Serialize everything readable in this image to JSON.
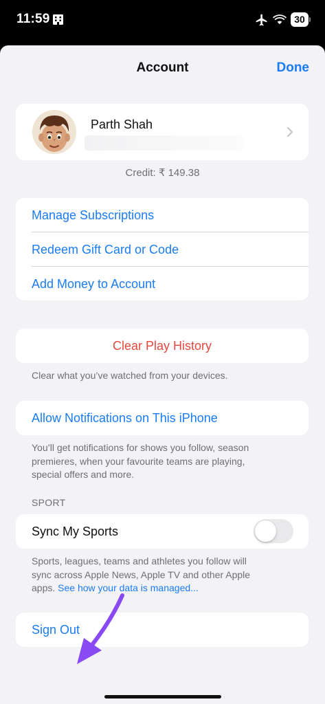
{
  "status_bar": {
    "time": "11:59",
    "battery_level": "30",
    "icons": [
      "building-icon",
      "airplane-icon",
      "wifi-icon",
      "battery-icon"
    ]
  },
  "nav": {
    "title": "Account",
    "done_label": "Done"
  },
  "profile": {
    "name": "Parth Shah",
    "icons": [
      "avatar-memoji",
      "chevron-right-icon"
    ]
  },
  "credit": "Credit: ₹ 149.38",
  "links": [
    {
      "label": "Manage Subscriptions"
    },
    {
      "label": "Redeem Gift Card or Code"
    },
    {
      "label": "Add Money to Account"
    }
  ],
  "clear_history": {
    "label": "Clear Play History",
    "footnote": "Clear what you’ve watched from your devices."
  },
  "notifications": {
    "label": "Allow Notifications on This iPhone",
    "footnote_line1": "You’ll get notifications for shows you follow, season",
    "footnote_line2": "premieres, when your favourite teams are playing,",
    "footnote_line3": "special offers and more."
  },
  "sport": {
    "header": "SPORT",
    "label": "Sync My Sports",
    "toggle_on": false,
    "footnote_line1": "Sports, leagues, teams and athletes you follow will",
    "footnote_line2": "sync across Apple News, Apple TV and other Apple",
    "footnote_line3_prefix": "apps.",
    "footnote_link": "See how your data is managed..."
  },
  "sign_out": {
    "label": "Sign Out"
  },
  "colors": {
    "accent": "#1a7cf5",
    "destructive": "#e5483d",
    "background": "#f2f2f7",
    "annotation": "#8a4af3"
  }
}
